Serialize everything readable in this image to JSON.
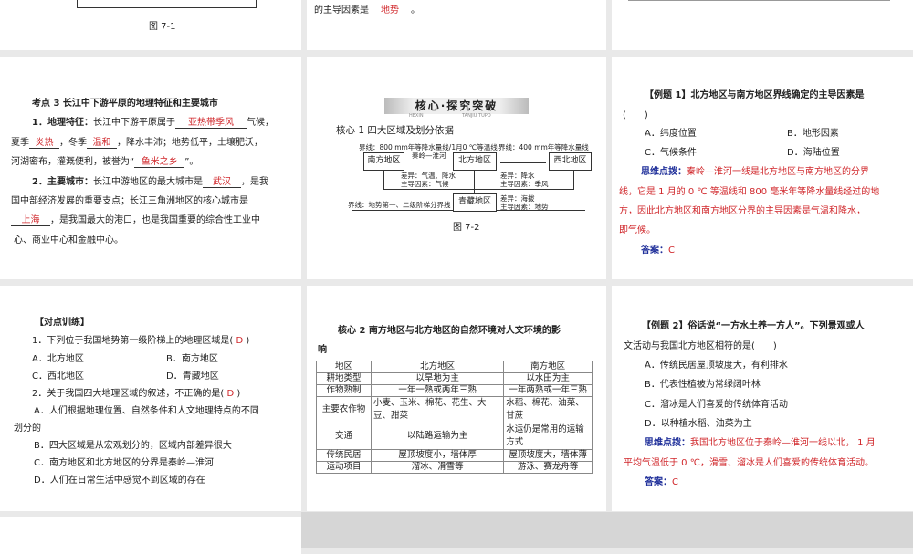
{
  "s1": {
    "fig": "图 7-1"
  },
  "s2": {
    "text": "的主导因素是",
    "blank": "地势",
    "end": "。"
  },
  "s4": {
    "title": "考点 3 长江中下游平原的地理特征和主要城市",
    "p1_label": "1．地理特征：",
    "p1_a": "长江中下游平原属于",
    "b1": "亚热带季风",
    "p1_b": "气候，",
    "p1_c": "夏季",
    "b2": "炎热",
    "p1_d": "，冬季",
    "b3": "温和",
    "p1_e": "，降水丰沛；地势低平，土壤肥沃，",
    "p1_f": "河湖密布，灌溉便利，被誉为“",
    "b4": "鱼米之乡",
    "p1_g": "”。",
    "p2_label": "2．主要城市：",
    "p2_a": "长江中游地区的最大城市是",
    "b5": "武汉",
    "p2_b": "，是我",
    "p2_c": "国中部经济发展的重要支点；长江三角洲地区的核心城市是",
    "b6": "上海",
    "p2_d": "，是我国最大的港口，也是我国重要的综合性工业中",
    "p2_e": "心、商业中心和金融中心。"
  },
  "s5": {
    "banner": "核心·探究突破",
    "banner_sub1": "HEXIN",
    "banner_sub2": "TANJIU TUPO",
    "heading": "核心 1 四大区域及划分依据",
    "boundary1": "界线：800 mm年等降水量线/1月0 ℃等温线",
    "boundary2": "界线：400 mm年等降水量线",
    "south": "南方地区",
    "north": "北方地区",
    "northwest": "西北地区",
    "qinghai": "青藏地区",
    "qinling": "秦岭—淮河",
    "diff1a": "差异：气温、降水",
    "diff1b": "主导因素：气候",
    "diff2a": "差异：降水",
    "diff2b": "主导因素：季风",
    "diff3a": "差异：海拔",
    "diff3b": "主导因素：地势",
    "boundary3": "界线：地势第一、二级阶梯分界线",
    "fig": "图 7-2"
  },
  "s6": {
    "q": "【例题 1】北方地区与南方地区界线确定的主导因素是",
    "paren": "(　　)",
    "options": [
      "A．纬度位置",
      "B．地形因素",
      "C．气候条件",
      "D．海陆位置"
    ],
    "hint_label": "思维点拨：",
    "hint": [
      "秦岭—淮河一线是北方地区与南方地区的分界",
      "线，它是 1 月的 0 ℃ 等温线和 800 毫米年等降水量线经过的地",
      "方，因此北方地区和南方地区分界的主导因素是气温和降水，",
      "即气候。"
    ],
    "answer_label": "答案：",
    "answer": "C"
  },
  "s7": {
    "title": "【对点训练】",
    "q1": "1．下列位于我国地势第一级阶梯上的地理区域是(",
    "q1_ans": "D",
    "close": ")",
    "q1_opts": [
      "A．北方地区",
      "B．南方地区",
      "C．西北地区",
      "D．青藏地区"
    ],
    "q2": "2．关于我国四大地理区域的叙述，不正确的是(",
    "q2_ans": "D",
    "q2_opts": [
      "A．人们根据地理位置、自然条件和人文地理特点的不同",
      "划分的",
      "B．四大区域是从宏观划分的，区域内部差异很大",
      "C．南方地区和北方地区的分界是秦岭—淮河",
      "D．人们在日常生活中感觉不到区域的存在"
    ]
  },
  "s8": {
    "heading1": "核心 2 南方地区与北方地区的自然环境对人文环境的影",
    "heading2": "响",
    "table": [
      [
        "地区",
        "北方地区",
        "南方地区"
      ],
      [
        "耕地类型",
        "以旱地为主",
        "以水田为主"
      ],
      [
        "作物熟制",
        "一年一熟或两年三熟",
        "一年两熟或一年三熟"
      ],
      [
        "主要农作物",
        "小麦、玉米、棉花、花生、大豆、甜菜",
        "水稻、棉花、油菜、甘蔗"
      ],
      [
        "交通",
        "以陆路运输为主",
        "水运仍是常用的运输方式"
      ],
      [
        "传统民居",
        "屋顶坡度小，墙体厚",
        "屋顶坡度大，墙体薄"
      ],
      [
        "运动项目",
        "溜冰、滑雪等",
        "游泳、赛龙舟等"
      ]
    ]
  },
  "s9": {
    "q1": "【例题 2】俗话说“一方水土养一方人”。下列景观或人",
    "q2": "文活动与我国北方地区相符的是(　　)",
    "options": [
      "A．传统民居屋顶坡度大，有利排水",
      "B．代表性植被为常绿阔叶林",
      "C．溜冰是人们喜爱的传统体育活动",
      "D．以种植水稻、油菜为主"
    ],
    "hint_label": "思维点拨：",
    "hint": [
      "我国北方地区位于秦岭—淮河一线以北， 1 月",
      "平均气温低于 0 ℃，滑雪、溜冰是人们喜爱的传统体育活动。"
    ],
    "answer_label": "答案：",
    "answer": "C"
  }
}
